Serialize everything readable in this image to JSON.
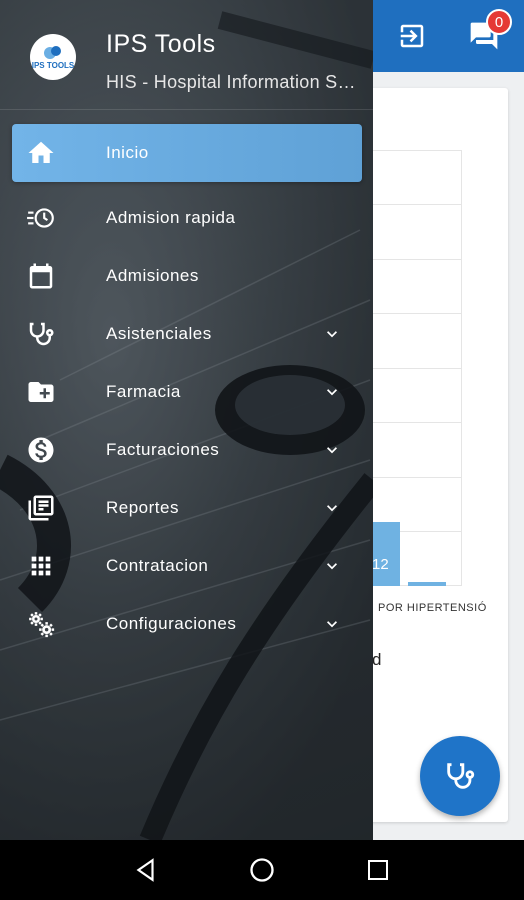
{
  "app": {
    "title": "IPS Tools",
    "subtitle": "HIS - Hospital Information System",
    "logo_text": "IPS TOOLS"
  },
  "topbar": {
    "notification_count": "0",
    "accent_color": "#1f6fbf"
  },
  "background_card": {
    "bar_value_label": "12",
    "category_label": "POR HIPERTENSIÓ",
    "partial_text": "d"
  },
  "menu": {
    "items": [
      {
        "label": "Inicio",
        "icon": "home-icon",
        "active": true,
        "expandable": false
      },
      {
        "label": "Admision rapida",
        "icon": "history-clock-icon",
        "active": false,
        "expandable": false
      },
      {
        "label": "Admisiones",
        "icon": "calendar-icon",
        "active": false,
        "expandable": false
      },
      {
        "label": "Asistenciales",
        "icon": "stethoscope-icon",
        "active": false,
        "expandable": true
      },
      {
        "label": "Farmacia",
        "icon": "folder-plus-icon",
        "active": false,
        "expandable": true
      },
      {
        "label": "Facturaciones",
        "icon": "dollar-icon",
        "active": false,
        "expandable": true
      },
      {
        "label": "Reportes",
        "icon": "report-icon",
        "active": false,
        "expandable": true
      },
      {
        "label": "Contratacion",
        "icon": "grid-icon",
        "active": false,
        "expandable": true
      },
      {
        "label": "Configuraciones",
        "icon": "gears-icon",
        "active": false,
        "expandable": true
      }
    ]
  },
  "colors": {
    "active_item": "#6aaee3",
    "fab": "#1f74c8",
    "badge": "#e53935"
  }
}
